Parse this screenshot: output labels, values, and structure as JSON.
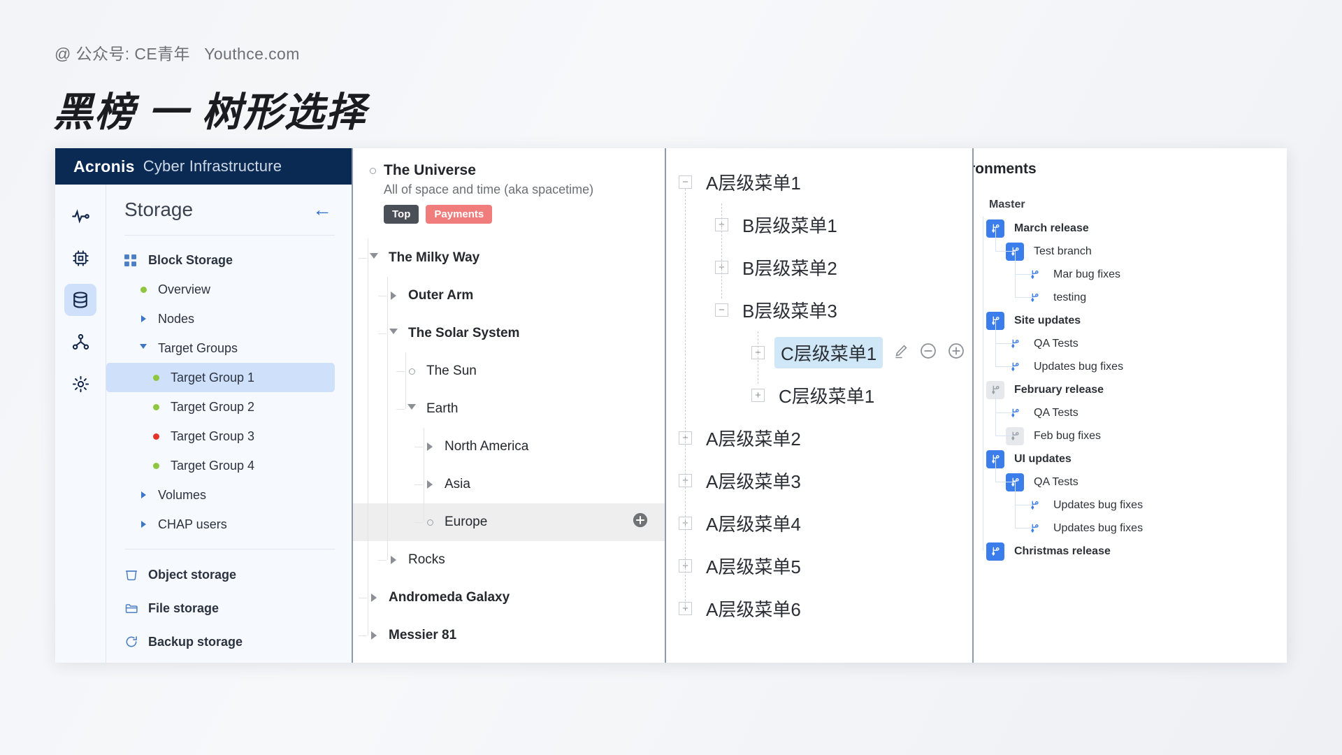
{
  "header": {
    "subtitle": "@ 公众号: CE青年   Youthce.com",
    "title": "黑榜 一 树形选择"
  },
  "panel_acronis": {
    "brand": "Acronis",
    "brand_suffix": "Cyber Infrastructure",
    "page_title": "Storage",
    "back_icon": "arrow-left-icon",
    "rail_icons": [
      "activity-monitor-icon",
      "compute-chip-icon",
      "storage-database-icon",
      "network-nodes-icon",
      "settings-gear-icon"
    ],
    "rail_active_index": 2,
    "tree": [
      {
        "label": "Block Storage",
        "indent": 1,
        "marker": "grid-icon",
        "bold": true
      },
      {
        "label": "Overview",
        "indent": 2,
        "marker": "dot-green"
      },
      {
        "label": "Nodes",
        "indent": 2,
        "marker": "caret-right"
      },
      {
        "label": "Target Groups",
        "indent": 2,
        "marker": "caret-down"
      },
      {
        "label": "Target Group 1",
        "indent": 3,
        "marker": "dot-green",
        "selected": true
      },
      {
        "label": "Target Group 2",
        "indent": 3,
        "marker": "dot-green"
      },
      {
        "label": "Target Group 3",
        "indent": 3,
        "marker": "dot-red"
      },
      {
        "label": "Target Group 4",
        "indent": 3,
        "marker": "dot-green"
      },
      {
        "label": "Volumes",
        "indent": 2,
        "marker": "caret-right"
      },
      {
        "label": "CHAP users",
        "indent": 2,
        "marker": "caret-right"
      }
    ],
    "storage_links": [
      {
        "label": "Object storage",
        "icon": "bucket-icon"
      },
      {
        "label": "File storage",
        "icon": "folder-icon"
      },
      {
        "label": "Backup storage",
        "icon": "refresh-circle-icon"
      }
    ]
  },
  "panel_universe": {
    "root": {
      "title": "The Universe",
      "description": "All of space and time (aka spacetime)",
      "badges": [
        {
          "label": "Top",
          "color": "#4b4f57"
        },
        {
          "label": "Payments",
          "color": "#f07c7c"
        }
      ],
      "marker": "ring-icon"
    },
    "nodes": [
      {
        "label": "The Milky Way",
        "indent": 1,
        "toggle": "open",
        "bold": true
      },
      {
        "label": "Outer Arm",
        "indent": 2,
        "toggle": "closed",
        "bold": true
      },
      {
        "label": "The Solar System",
        "indent": 2,
        "toggle": "open",
        "bold": true
      },
      {
        "label": "The Sun",
        "indent": 3,
        "toggle": "leaf"
      },
      {
        "label": "Earth",
        "indent": 3,
        "toggle": "open"
      },
      {
        "label": "North America",
        "indent": 4,
        "toggle": "closed"
      },
      {
        "label": "Asia",
        "indent": 4,
        "toggle": "closed"
      },
      {
        "label": "Europe",
        "indent": 4,
        "toggle": "leaf",
        "hovered": true,
        "action_icon": "plus-circle-icon"
      },
      {
        "label": "Rocks",
        "indent": 2,
        "toggle": "closed"
      },
      {
        "label": "Andromeda Galaxy",
        "indent": 1,
        "toggle": "closed",
        "bold": true
      },
      {
        "label": "Messier 81",
        "indent": 1,
        "toggle": "closed",
        "bold": true
      }
    ],
    "cursor": "hand-pointer-cursor"
  },
  "panel_hierarchy": {
    "nodes": [
      {
        "label": "A层级菜单1",
        "indent": 0,
        "box": "minus"
      },
      {
        "label": "B层级菜单1",
        "indent": 1,
        "box": "plus"
      },
      {
        "label": "B层级菜单2",
        "indent": 1,
        "box": "plus"
      },
      {
        "label": "B层级菜单3",
        "indent": 1,
        "box": "minus"
      },
      {
        "label": "C层级菜单1",
        "indent": 2,
        "box": "plus",
        "selected": true,
        "actions": [
          "edit-pencil-icon",
          "minus-circle-icon",
          "plus-circle-icon"
        ]
      },
      {
        "label": "C层级菜单1",
        "indent": 2,
        "box": "plus"
      },
      {
        "label": "A层级菜单2",
        "indent": 0,
        "box": "plus"
      },
      {
        "label": "A层级菜单3",
        "indent": 0,
        "box": "plus"
      },
      {
        "label": "A层级菜单4",
        "indent": 0,
        "box": "plus"
      },
      {
        "label": "A层级菜单5",
        "indent": 0,
        "box": "plus"
      },
      {
        "label": "A层级菜单6",
        "indent": 0,
        "box": "plus"
      }
    ]
  },
  "panel_git": {
    "title": "ronments",
    "root_label": "Master",
    "nodes": [
      {
        "label": "March release",
        "indent": 0,
        "chip": "blue",
        "bold": true
      },
      {
        "label": "Test branch",
        "indent": 1,
        "chip": "blue",
        "bold": false
      },
      {
        "label": "Mar bug fixes",
        "indent": 2,
        "chip": "none"
      },
      {
        "label": "testing",
        "indent": 2,
        "chip": "none"
      },
      {
        "label": "Site updates",
        "indent": 0,
        "chip": "blue",
        "bold": true
      },
      {
        "label": "QA Tests",
        "indent": 1,
        "chip": "none"
      },
      {
        "label": "Updates bug fixes",
        "indent": 1,
        "chip": "none"
      },
      {
        "label": "February release",
        "indent": 0,
        "chip": "gray",
        "bold": true
      },
      {
        "label": "QA Tests",
        "indent": 1,
        "chip": "none"
      },
      {
        "label": "Feb bug fixes",
        "indent": 1,
        "chip": "gray"
      },
      {
        "label": "UI updates",
        "indent": 0,
        "chip": "blue",
        "bold": true
      },
      {
        "label": "QA Tests",
        "indent": 1,
        "chip": "blue"
      },
      {
        "label": "Updates bug fixes",
        "indent": 2,
        "chip": "none"
      },
      {
        "label": "Updates bug fixes",
        "indent": 2,
        "chip": "none"
      },
      {
        "label": "Christmas release",
        "indent": 0,
        "chip": "blue",
        "bold": true
      }
    ]
  },
  "colors": {
    "brand_navy": "#0a2a54",
    "accent_blue": "#3b7dea",
    "selection_blue": "#cfe0fa",
    "selection_cyan": "#cfe7f7",
    "status_green": "#8ec63f",
    "status_red": "#e4332b",
    "badge_red": "#f07c7c"
  }
}
